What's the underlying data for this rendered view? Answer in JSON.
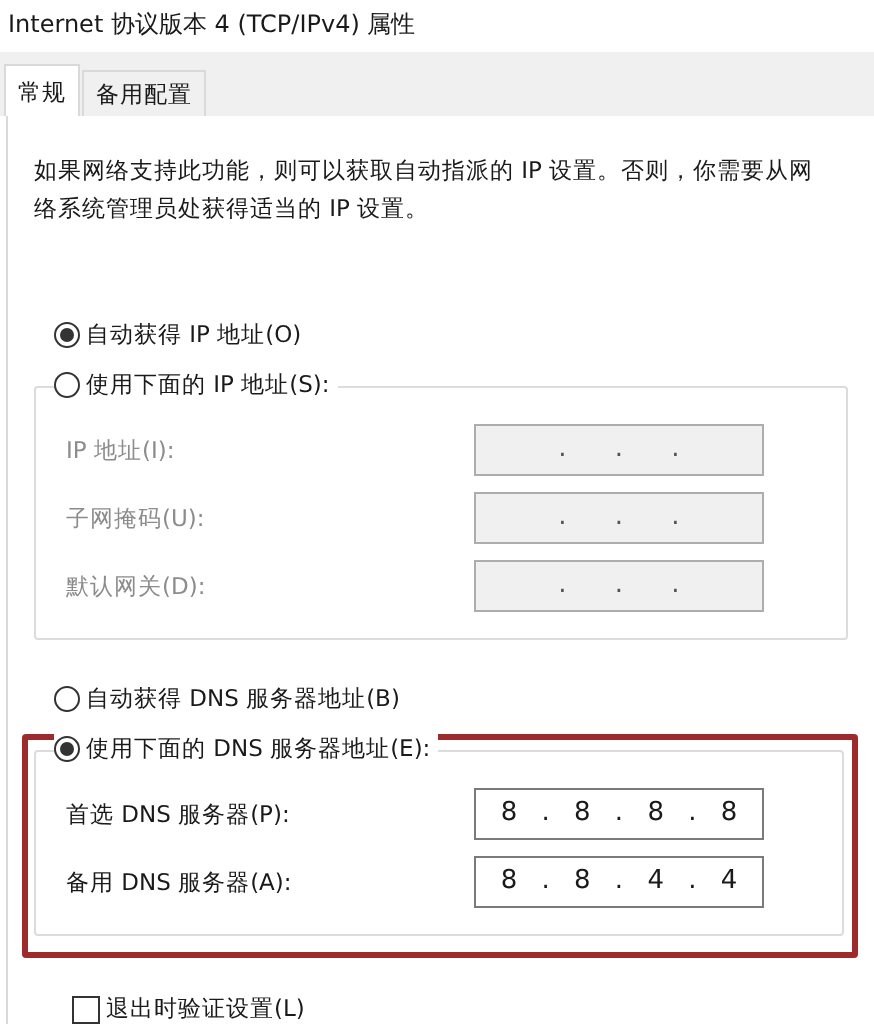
{
  "window": {
    "title": "Internet 协议版本 4 (TCP/IPv4) 属性"
  },
  "tabs": [
    {
      "label": "常规",
      "selected": true
    },
    {
      "label": "备用配置",
      "selected": false
    }
  ],
  "description": "如果网络支持此功能，则可以获取自动指派的 IP 设置。否则，你需要从网络系统管理员处获得适当的 IP 设置。",
  "ip_section": {
    "auto_option": {
      "label": "自动获得 IP 地址(O)",
      "selected": true
    },
    "manual_group": {
      "label": "使用下面的 IP 地址(S):",
      "selected": false,
      "disabled": true,
      "highlighted": false,
      "fields": [
        {
          "label": "IP 地址(I):",
          "value": ". . ."
        },
        {
          "label": "子网掩码(U):",
          "value": ". . ."
        },
        {
          "label": "默认网关(D):",
          "value": ". . ."
        }
      ]
    }
  },
  "dns_section": {
    "auto_option": {
      "label": "自动获得 DNS 服务器地址(B)",
      "selected": false
    },
    "manual_group": {
      "label": "使用下面的 DNS 服务器地址(E):",
      "selected": true,
      "disabled": false,
      "highlighted": true,
      "fields": [
        {
          "label": "首选 DNS 服务器(P):",
          "value": "8 . 8 . 8 . 8"
        },
        {
          "label": "备用 DNS 服务器(A):",
          "value": "8 . 8 . 4 . 4"
        }
      ]
    }
  },
  "validate_checkbox": {
    "label": "退出时验证设置(L)",
    "checked": false
  }
}
